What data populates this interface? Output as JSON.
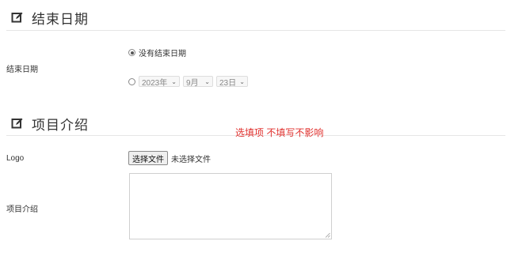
{
  "section_end_date": {
    "title": "结束日期",
    "icon": "edit-icon"
  },
  "end_date_field": {
    "label": "结束日期",
    "option_no_end": "没有结束日期",
    "year": "2023年",
    "month": "9月",
    "day": "23日"
  },
  "section_intro": {
    "title": "项目介绍",
    "icon": "edit-icon"
  },
  "hint_text": "选填项 不填写不影响",
  "logo_field": {
    "label": "Logo",
    "button": "选择文件",
    "status": "未选择文件"
  },
  "intro_field": {
    "label": "项目介绍",
    "value": ""
  },
  "colors": {
    "hint": "#e0302d",
    "divider": "#e6e6e6"
  }
}
